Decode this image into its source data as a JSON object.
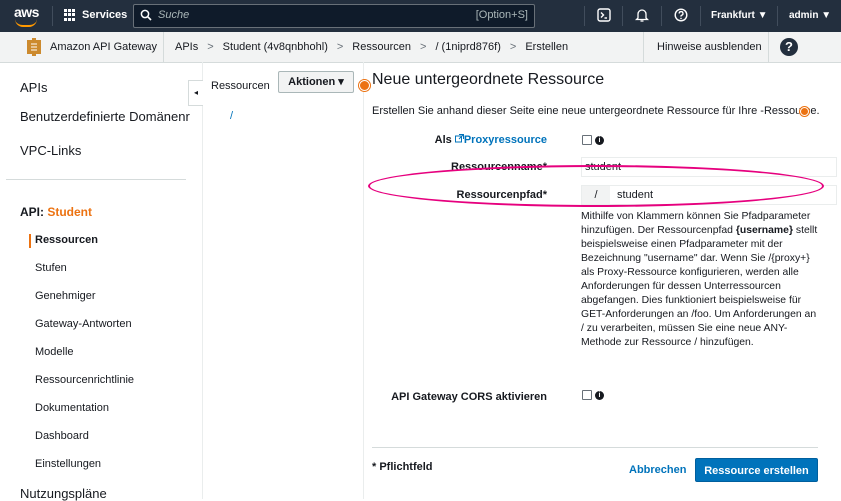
{
  "topnav": {
    "logo_text": "aws",
    "services_label": "Services",
    "search_placeholder": "Suche",
    "search_shortcut": "[Option+S]",
    "region": "Frankfurt ▼",
    "user": "admin ▼"
  },
  "breadcrumb": {
    "service": "Amazon API Gateway",
    "items": [
      "APIs",
      "Student (4v8qnbhohl)",
      "Ressourcen",
      "/ (1niprd876f)",
      "Erstellen"
    ],
    "separator": ">",
    "hide_tips": "Hinweise ausblenden",
    "help": "?"
  },
  "sidebar": {
    "top_items": [
      "APIs",
      "Benutzerdefinierte Domänenr",
      "VPC-Links"
    ],
    "api_prefix": "API:",
    "api_name": "Student",
    "items": [
      "Ressourcen",
      "Stufen",
      "Genehmiger",
      "Gateway-Antworten",
      "Modelle",
      "Ressourcenrichtlinie",
      "Dokumentation",
      "Dashboard",
      "Einstellungen"
    ],
    "bottom_item": "Nutzungspläne",
    "collapse_glyph": "◂"
  },
  "resources": {
    "title": "Ressourcen",
    "actions_label": "Aktionen ▾",
    "root": "/"
  },
  "main": {
    "title": "Neue untergeordnete Ressource",
    "description": "Erstellen Sie anhand dieser Seite eine neue untergeordnete Ressource für Ihre -Ressource.",
    "proxy_prefix": "Als",
    "proxy_link": "Proxyressource",
    "name_label": "Ressourcenname*",
    "name_value": "student",
    "path_label": "Ressourcenpfad*",
    "path_prefix": "/",
    "path_value": "student",
    "help_pre": "Mithilfe von Klammern können Sie Pfadparameter hinzufügen. Der Ressourcenpfad ",
    "help_bold": "{username}",
    "help_post": " stellt beispielsweise einen Pfadparameter mit der Bezeichnung \"username\" dar. Wenn Sie /{proxy+} als Proxy-Ressource konfigurieren, werden alle Anforderungen für dessen Unterressourcen abgefangen. Dies funktioniert beispielsweise für GET-Anforderungen an /foo. Um Anforderungen an / zu verarbeiten, müssen Sie eine neue ANY-Methode zur Ressource / hinzufügen.",
    "cors_label": "API Gateway CORS aktivieren",
    "required_note": "* Pflichtfeld",
    "cancel_label": "Abbrechen",
    "create_label": "Ressource erstellen",
    "info_glyph": "i"
  },
  "colors": {
    "nav_bg": "#232f3e",
    "accent_orange": "#ec7211",
    "link_blue": "#0073bb",
    "highlight": "#e6007e"
  },
  "icons": [
    "grid-icon",
    "search-icon",
    "terminal-icon",
    "bell-icon",
    "help-circle-icon",
    "api-gateway-icon",
    "info-icon",
    "external-link-icon"
  ]
}
